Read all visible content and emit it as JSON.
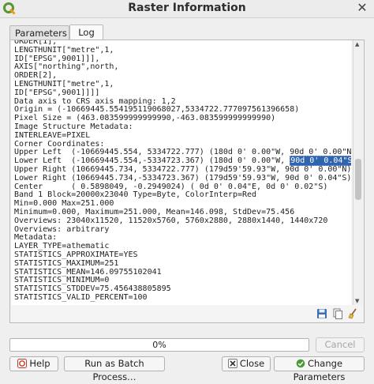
{
  "window": {
    "title": "Raster Information"
  },
  "tabs": [
    {
      "label": "Parameters"
    },
    {
      "label": "Log"
    }
  ],
  "log": {
    "lines": [
      "ORDER[1],",
      "LENGTHUNIT[\"metre\",1,",
      "ID[\"EPSG\",9001]]],",
      "AXIS[\"northing\",north,",
      "ORDER[2],",
      "LENGTHUNIT[\"metre\",1,",
      "ID[\"EPSG\",9001]]]]",
      "Data axis to CRS axis mapping: 1,2",
      "Origin = (-10669445.554195119068027,5334722.777097561396658)",
      "Pixel Size = (463.083599999999990,-463.083599999999990)",
      "Image Structure Metadata:",
      "INTERLEAVE=PIXEL",
      "Corner Coordinates:",
      "Upper Left  (-10669445.554, 5334722.777) (180d 0' 0.00\"W, 90d 0' 0.00\"N)",
      "Lower Left  (-10669445.554,-5334723.367) (180d 0' 0.00\"W, ",
      "Upper Right (10669445.734, 5334722.777) (179d59'59.93\"W, 90d 0' 0.00\"N)",
      "Lower Right (10669445.734,-5334723.367) (179d59'59.93\"W, 90d 0' 0.04\"S)",
      "Center      ( 0.5898049, -0.2949024) ( 0d 0' 0.04\"E, 0d 0' 0.02\"S)",
      "Band 1 Block=20000x23040 Type=Byte, ColorInterp=Red",
      "Min=0.000 Max=251.000",
      "Minimum=0.000, Maximum=251.000, Mean=146.098, StdDev=75.456",
      "Overviews: 23040x11520, 11520x5760, 5760x2880, 2880x1440, 1440x720",
      "Overviews: arbitrary",
      "Metadata:",
      "LAYER_TYPE=athematic",
      "STATISTICS_APPROXIMATE=YES",
      "STATISTICS_MAXIMUM=251",
      "STATISTICS_MEAN=146.09755102041",
      "STATISTICS_MINIMUM=0",
      "STATISTICS_STDDEV=75.456438805895",
      "STATISTICS_VALID_PERCENT=100"
    ],
    "selected_text": "90d 0' 0.04\"S",
    "selected_line_suffix": ")"
  },
  "progress": {
    "value": 0,
    "label": "0%"
  },
  "buttons": {
    "cancel": "Cancel",
    "help": "Help",
    "batch": "Run as Batch Process…",
    "close": "Close",
    "change_parameters": "Change Parameters"
  },
  "colors": {
    "selection": "#2f64b0",
    "qgis_green": "#589632",
    "qgis_yellow": "#ee7913"
  }
}
